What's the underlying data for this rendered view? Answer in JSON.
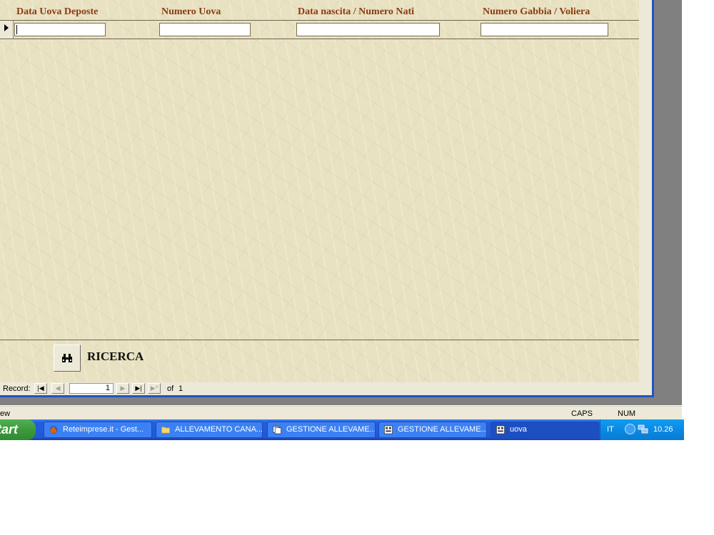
{
  "form": {
    "columns": [
      "Data Uova Deposte",
      "Numero Uova",
      "Data nascita / Numero Nati",
      "Numero Gabbia / Voliera"
    ],
    "fields": [
      "",
      "",
      "",
      ""
    ],
    "search_label": "RICERCA"
  },
  "record_nav": {
    "label": "Record:",
    "current": "1",
    "of_label": "of",
    "total": "1"
  },
  "status_bar": {
    "text": "ew",
    "caps": "CAPS",
    "num": "NUM"
  },
  "taskbar": {
    "start_label": "tart",
    "tasks": [
      {
        "label": "Reteimprese.it - Gest...",
        "icon": "firefox-icon"
      },
      {
        "label": "ALLEVAMENTO CANA...",
        "icon": "folder-icon"
      },
      {
        "label": "GESTIONE ALLEVAME...",
        "icon": "access-icon"
      },
      {
        "label": "GESTIONE ALLEVAME...",
        "icon": "form-icon"
      },
      {
        "label": "uova",
        "icon": "form-icon"
      }
    ],
    "language": "IT",
    "clock": "10.26"
  },
  "colors": {
    "header_text": "#8a3b12",
    "form_background": "#e9e2c2",
    "taskbar": "#245edb",
    "tray": "#0b8ae3"
  }
}
